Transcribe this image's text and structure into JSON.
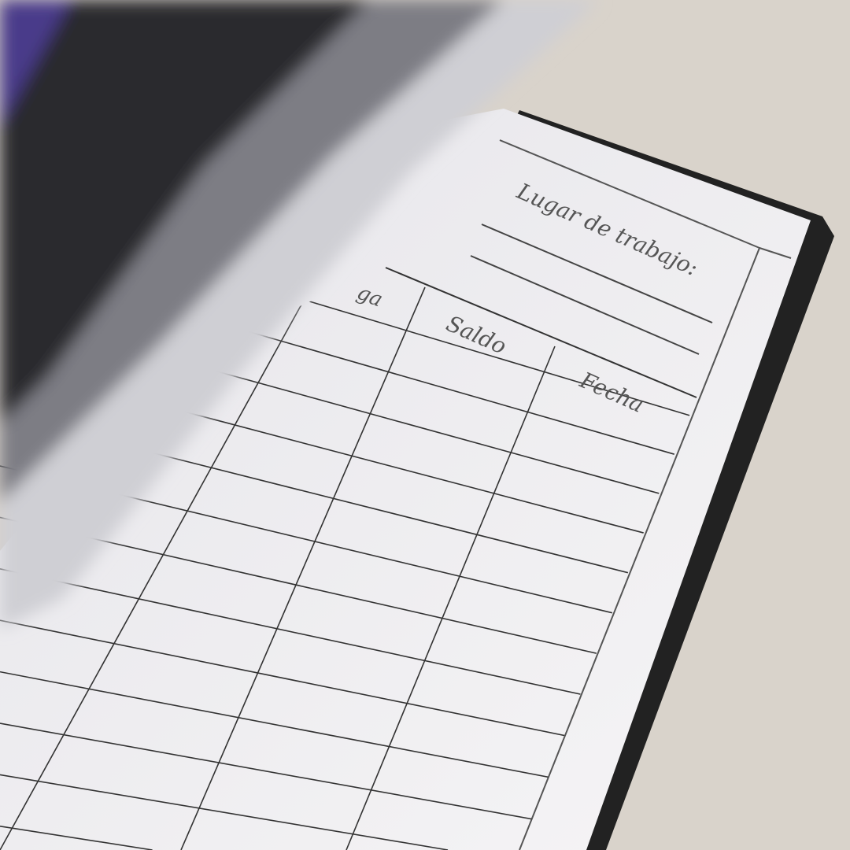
{
  "notebook": {
    "header_label": "Lugar de trabajo:",
    "columns": [
      "ga",
      "Saldo",
      "Fecha"
    ]
  },
  "colors": {
    "table_background": "#d9d3cb",
    "page": "#f4f3f4",
    "cover": "#222222",
    "ink": "#444444"
  }
}
